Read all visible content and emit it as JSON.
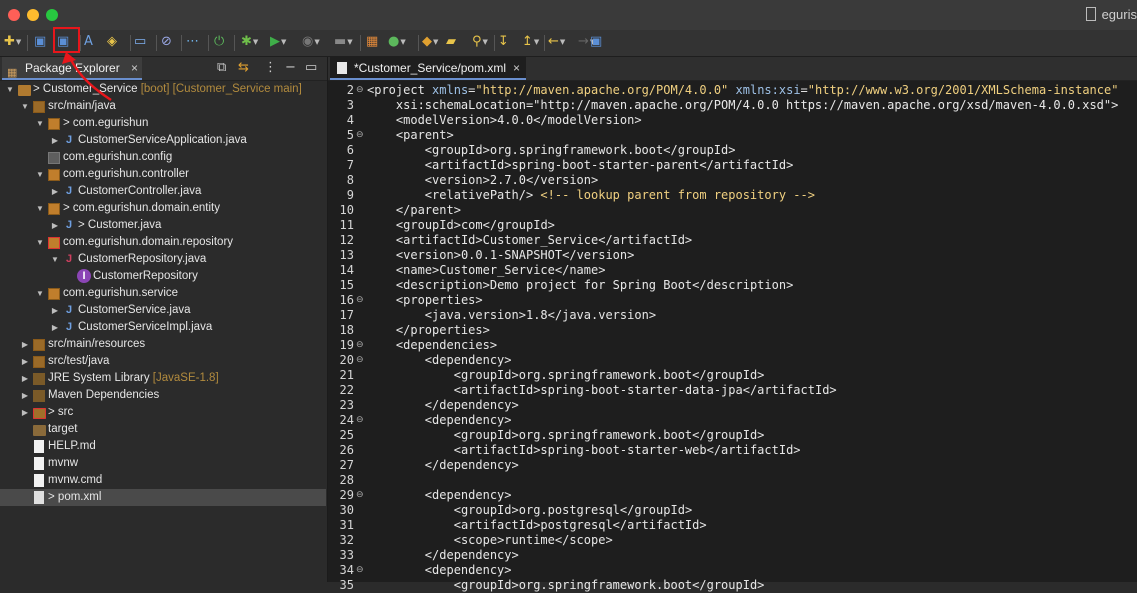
{
  "window": {
    "title_user": "eguris",
    "traffic_lights": [
      "close",
      "minimize",
      "maximize"
    ]
  },
  "toolbar": {
    "buttons": [
      {
        "name": "new-icon",
        "glyph": "✚",
        "color": "#e8c44a",
        "dropdown": true
      },
      {
        "name": "save-icon",
        "glyph": "▣",
        "color": "#5b8fd6",
        "dropdown": false
      },
      {
        "name": "save-all-icon",
        "glyph": "▣",
        "color": "#5b8fd6",
        "dropdown": false,
        "highlighted": true
      },
      {
        "name": "spelling-icon",
        "glyph": "A",
        "color": "#6fa0e0",
        "dropdown": false
      },
      {
        "name": "open-task-icon",
        "glyph": "◈",
        "color": "#e8c44a",
        "dropdown": false
      },
      {
        "name": "terminal-icon",
        "glyph": "▭",
        "color": "#7fb0f0",
        "dropdown": false
      },
      {
        "name": "skip-breakpoints-icon",
        "glyph": "⊘",
        "color": "#9aa8e6",
        "dropdown": false
      },
      {
        "name": "bookmark-icon",
        "glyph": "⋯",
        "color": "#6fb0e6",
        "dropdown": false
      },
      {
        "name": "spring-icon",
        "glyph": "⏻",
        "color": "#5cb85c",
        "dropdown": false
      },
      {
        "name": "debug-icon",
        "glyph": "✱",
        "color": "#6fbf4a",
        "dropdown": true
      },
      {
        "name": "run-icon",
        "glyph": "▶",
        "color": "#3fae49",
        "dropdown": true
      },
      {
        "name": "coverage-icon",
        "glyph": "◉",
        "color": "#777777",
        "dropdown": true
      },
      {
        "name": "external-tools-icon",
        "glyph": "▬",
        "color": "#888888",
        "dropdown": true
      },
      {
        "name": "new-java-project-icon",
        "glyph": "▦",
        "color": "#e0883a",
        "dropdown": false
      },
      {
        "name": "new-class-icon",
        "glyph": "●",
        "color": "#5cb85c",
        "dropdown": true
      },
      {
        "name": "new-package-icon",
        "glyph": "◆",
        "color": "#e0a030",
        "dropdown": true
      },
      {
        "name": "open-type-icon",
        "glyph": "▰",
        "color": "#e8c44a",
        "dropdown": false
      },
      {
        "name": "search-icon",
        "glyph": "⚲",
        "color": "#e8c44a",
        "dropdown": true
      },
      {
        "name": "next-annotation-icon",
        "glyph": "↧",
        "color": "#e8c44a",
        "dropdown": false
      },
      {
        "name": "previous-annotation-icon",
        "glyph": "↥",
        "color": "#e8c44a",
        "dropdown": true
      },
      {
        "name": "back-icon",
        "glyph": "←",
        "color": "#e8c44a",
        "dropdown": true
      },
      {
        "name": "forward-icon",
        "glyph": "→",
        "color": "#666666",
        "dropdown": true
      },
      {
        "name": "perspective-icon",
        "glyph": "▣",
        "color": "#5b8fd6",
        "dropdown": false
      }
    ]
  },
  "package_explorer": {
    "tab_label": "Package Explorer",
    "tree": [
      {
        "depth": 0,
        "expand": "down",
        "icon": "project",
        "prefix": ">",
        "label": "Customer_Service",
        "decoration": "[boot] [Customer_Service main]"
      },
      {
        "depth": 1,
        "expand": "down",
        "icon": "srcfolder",
        "prefix": "",
        "label": "src/main/java",
        "decoration": ""
      },
      {
        "depth": 2,
        "expand": "down",
        "icon": "package",
        "prefix": ">",
        "label": "com.egurishun",
        "decoration": ""
      },
      {
        "depth": 3,
        "expand": "right",
        "icon": "java",
        "prefix": "",
        "label": "CustomerServiceApplication.java",
        "decoration": ""
      },
      {
        "depth": 2,
        "expand": "none",
        "icon": "package-empty",
        "prefix": "",
        "label": "com.egurishun.config",
        "decoration": ""
      },
      {
        "depth": 2,
        "expand": "down",
        "icon": "package",
        "prefix": "",
        "label": "com.egurishun.controller",
        "decoration": ""
      },
      {
        "depth": 3,
        "expand": "right",
        "icon": "java",
        "prefix": "",
        "label": "CustomerController.java",
        "decoration": ""
      },
      {
        "depth": 2,
        "expand": "down",
        "icon": "package",
        "prefix": ">",
        "label": "com.egurishun.domain.entity",
        "decoration": ""
      },
      {
        "depth": 3,
        "expand": "right",
        "icon": "java",
        "prefix": ">",
        "label": "Customer.java",
        "decoration": ""
      },
      {
        "depth": 2,
        "expand": "down",
        "icon": "package-error",
        "prefix": "",
        "label": "com.egurishun.domain.repository",
        "decoration": ""
      },
      {
        "depth": 3,
        "expand": "down",
        "icon": "java-error",
        "prefix": "",
        "label": "CustomerRepository.java",
        "decoration": ""
      },
      {
        "depth": 4,
        "expand": "none",
        "icon": "interface",
        "prefix": "",
        "label": "CustomerRepository",
        "decoration": ""
      },
      {
        "depth": 2,
        "expand": "down",
        "icon": "package",
        "prefix": "",
        "label": "com.egurishun.service",
        "decoration": ""
      },
      {
        "depth": 3,
        "expand": "right",
        "icon": "java",
        "prefix": "",
        "label": "CustomerService.java",
        "decoration": ""
      },
      {
        "depth": 3,
        "expand": "right",
        "icon": "java",
        "prefix": "",
        "label": "CustomerServiceImpl.java",
        "decoration": ""
      },
      {
        "depth": 1,
        "expand": "right",
        "icon": "srcfolder",
        "prefix": "",
        "label": "src/main/resources",
        "decoration": ""
      },
      {
        "depth": 1,
        "expand": "right",
        "icon": "srcfolder",
        "prefix": "",
        "label": "src/test/java",
        "decoration": ""
      },
      {
        "depth": 1,
        "expand": "right",
        "icon": "library",
        "prefix": "",
        "label": "JRE System Library",
        "decoration": "[JavaSE-1.8]"
      },
      {
        "depth": 1,
        "expand": "right",
        "icon": "library",
        "prefix": "",
        "label": "Maven Dependencies",
        "decoration": ""
      },
      {
        "depth": 1,
        "expand": "right",
        "icon": "folder-error",
        "prefix": ">",
        "label": "src",
        "decoration": ""
      },
      {
        "depth": 1,
        "expand": "none",
        "icon": "folder",
        "prefix": "",
        "label": "target",
        "decoration": ""
      },
      {
        "depth": 1,
        "expand": "none",
        "icon": "file",
        "prefix": "",
        "label": "HELP.md",
        "decoration": ""
      },
      {
        "depth": 1,
        "expand": "none",
        "icon": "file",
        "prefix": "",
        "label": "mvnw",
        "decoration": ""
      },
      {
        "depth": 1,
        "expand": "none",
        "icon": "file",
        "prefix": "",
        "label": "mvnw.cmd",
        "decoration": ""
      },
      {
        "depth": 1,
        "expand": "none",
        "icon": "xml",
        "prefix": ">",
        "label": "pom.xml",
        "decoration": "",
        "selected": true
      }
    ]
  },
  "editor": {
    "tab_label": "*Customer_Service/pom.xml",
    "lines": [
      {
        "n": "2",
        "fold": true,
        "text": "<project xmlns=\"http://maven.apache.org/POM/4.0.0\" xmlns:xsi=\"http://www.w3.org/2001/XMLSchema-instance\""
      },
      {
        "n": "3",
        "fold": false,
        "text": "    xsi:schemaLocation=\"http://maven.apache.org/POM/4.0.0 https://maven.apache.org/xsd/maven-4.0.0.xsd\">"
      },
      {
        "n": "4",
        "fold": false,
        "text": "    <modelVersion>4.0.0</modelVersion>"
      },
      {
        "n": "5",
        "fold": true,
        "text": "    <parent>"
      },
      {
        "n": "6",
        "fold": false,
        "text": "        <groupId>org.springframework.boot</groupId>"
      },
      {
        "n": "7",
        "fold": false,
        "text": "        <artifactId>spring-boot-starter-parent</artifactId>"
      },
      {
        "n": "8",
        "fold": false,
        "text": "        <version>2.7.0</version>"
      },
      {
        "n": "9",
        "fold": false,
        "text": "        <relativePath/> <!-- lookup parent from repository -->"
      },
      {
        "n": "10",
        "fold": false,
        "text": "    </parent>"
      },
      {
        "n": "11",
        "fold": false,
        "text": "    <groupId>com</groupId>"
      },
      {
        "n": "12",
        "fold": false,
        "text": "    <artifactId>Customer_Service</artifactId>"
      },
      {
        "n": "13",
        "fold": false,
        "text": "    <version>0.0.1-SNAPSHOT</version>"
      },
      {
        "n": "14",
        "fold": false,
        "text": "    <name>Customer_Service</name>"
      },
      {
        "n": "15",
        "fold": false,
        "text": "    <description>Demo project for Spring Boot</description>"
      },
      {
        "n": "16",
        "fold": true,
        "text": "    <properties>"
      },
      {
        "n": "17",
        "fold": false,
        "text": "        <java.version>1.8</java.version>"
      },
      {
        "n": "18",
        "fold": false,
        "text": "    </properties>"
      },
      {
        "n": "19",
        "fold": true,
        "text": "    <dependencies>"
      },
      {
        "n": "20",
        "fold": true,
        "text": "        <dependency>"
      },
      {
        "n": "21",
        "fold": false,
        "text": "            <groupId>org.springframework.boot</groupId>"
      },
      {
        "n": "22",
        "fold": false,
        "text": "            <artifactId>spring-boot-starter-data-jpa</artifactId>"
      },
      {
        "n": "23",
        "fold": false,
        "text": "        </dependency>"
      },
      {
        "n": "24",
        "fold": true,
        "text": "        <dependency>"
      },
      {
        "n": "25",
        "fold": false,
        "text": "            <groupId>org.springframework.boot</groupId>"
      },
      {
        "n": "26",
        "fold": false,
        "text": "            <artifactId>spring-boot-starter-web</artifactId>"
      },
      {
        "n": "27",
        "fold": false,
        "text": "        </dependency>"
      },
      {
        "n": "28",
        "fold": false,
        "text": ""
      },
      {
        "n": "29",
        "fold": true,
        "text": "        <dependency>"
      },
      {
        "n": "30",
        "fold": false,
        "text": "            <groupId>org.postgresql</groupId>"
      },
      {
        "n": "31",
        "fold": false,
        "text": "            <artifactId>postgresql</artifactId>"
      },
      {
        "n": "32",
        "fold": false,
        "text": "            <scope>runtime</scope>"
      },
      {
        "n": "33",
        "fold": false,
        "text": "        </dependency>"
      },
      {
        "n": "34",
        "fold": true,
        "text": "        <dependency>"
      },
      {
        "n": "35",
        "fold": false,
        "text": "            <groupId>org.springframework.boot</groupId>"
      }
    ]
  }
}
